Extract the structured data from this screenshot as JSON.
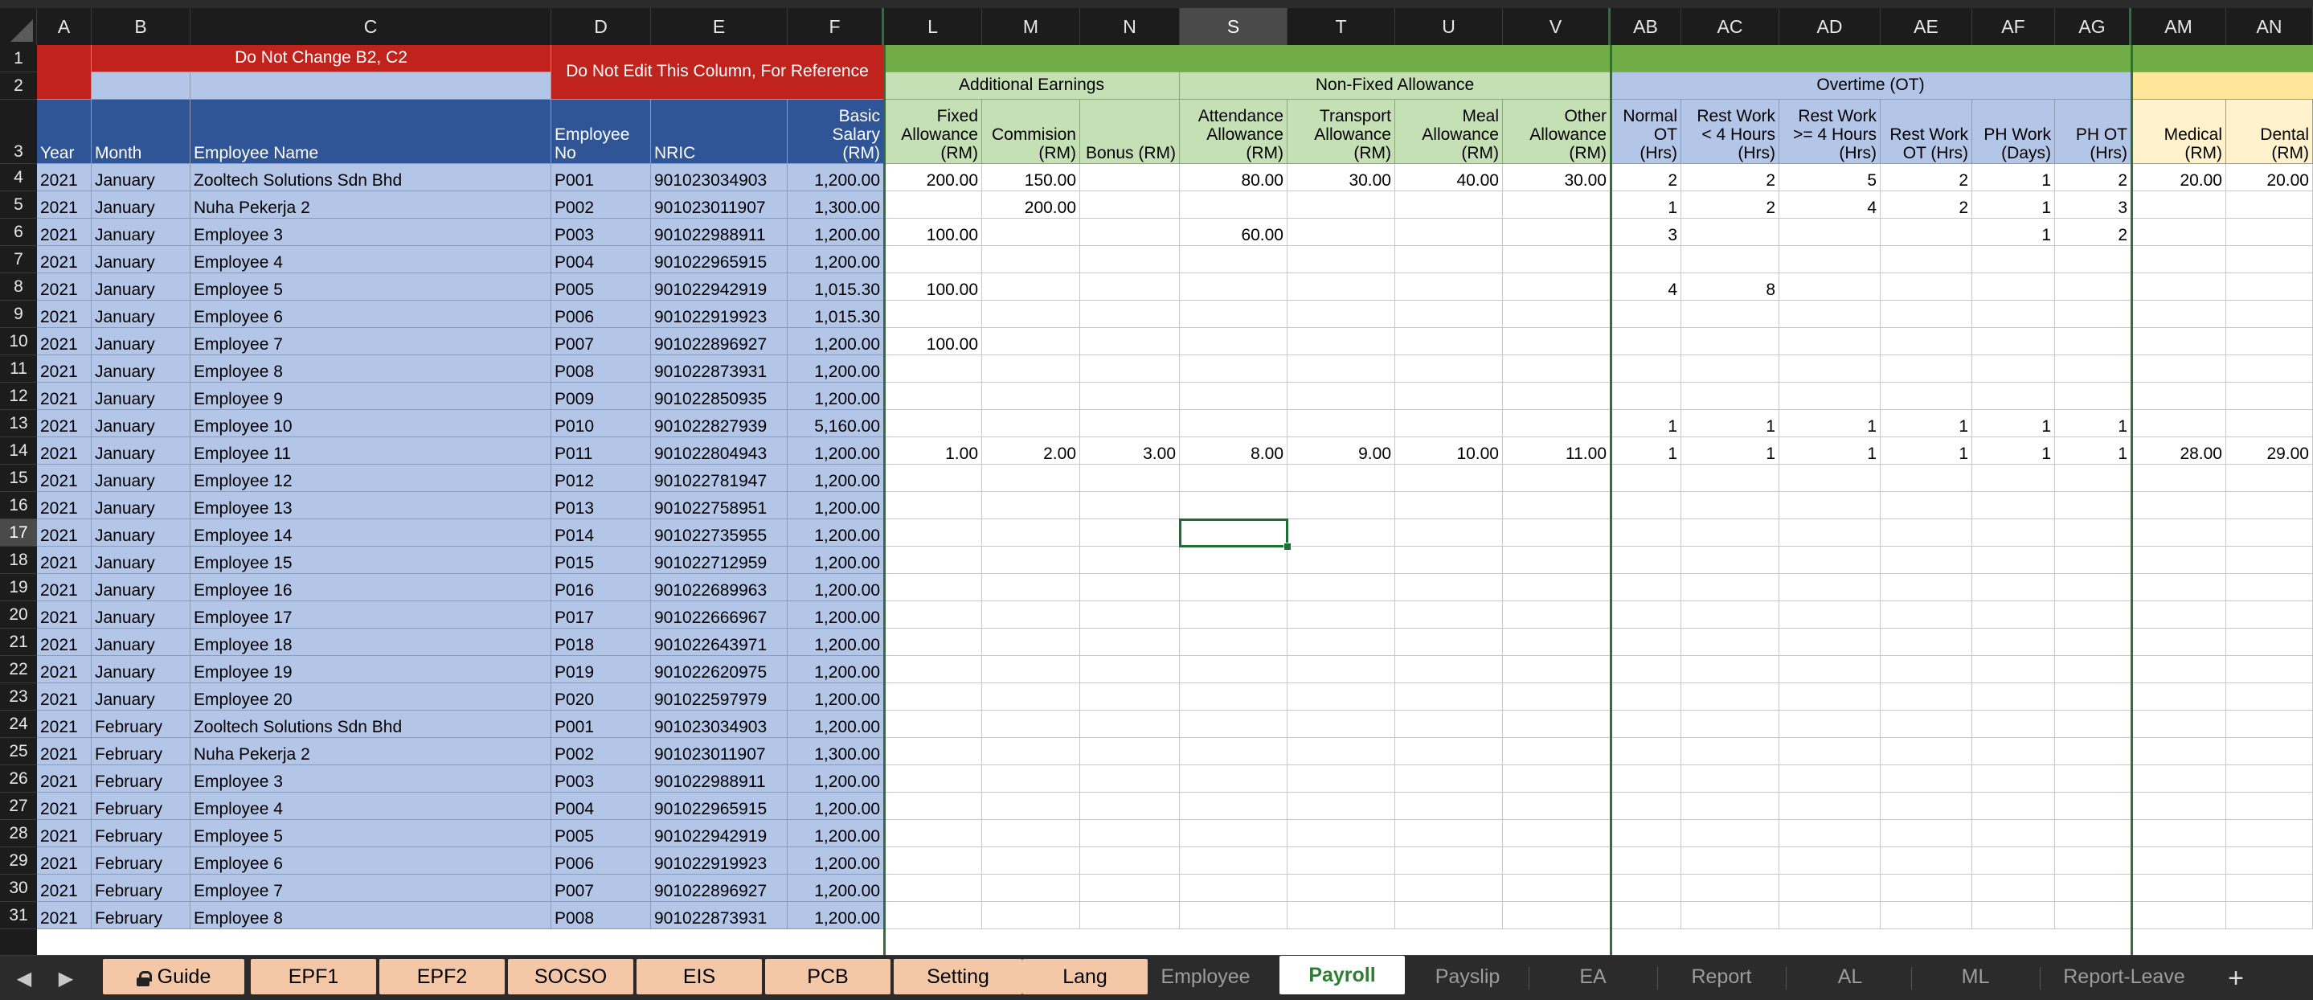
{
  "columns": [
    "A",
    "B",
    "C",
    "D",
    "E",
    "F",
    "L",
    "M",
    "N",
    "S",
    "T",
    "U",
    "V",
    "AB",
    "AC",
    "AD",
    "AE",
    "AF",
    "AG",
    "AM",
    "AN"
  ],
  "selected_column": "S",
  "selected_row": "17",
  "header_rows": {
    "row1_red_left": "Do Not Change B2, C2",
    "row1_2_red_right": "Do Not Edit This Column, For Reference",
    "group_additional": "Additional Earnings",
    "group_nonfixed": "Non-Fixed Allowance",
    "group_overtime": "Overtime (OT)"
  },
  "col_titles": {
    "A": "Year",
    "B": "Month",
    "C": "Employee Name",
    "D": "Employee No",
    "E": "NRIC",
    "F": "Basic Salary (RM)",
    "L": "Fixed Allowance (RM)",
    "M": "Commision (RM)",
    "N": "Bonus (RM)",
    "S": "Attendance Allowance (RM)",
    "T": "Transport Allowance (RM)",
    "U": "Meal Allowance (RM)",
    "V": "Other Allowance (RM)",
    "AB": "Normal OT (Hrs)",
    "AC": "Rest Work < 4 Hours (Hrs)",
    "AD": "Rest Work >= 4 Hours (Hrs)",
    "AE": "Rest Work OT (Hrs)",
    "AF": "PH Work (Days)",
    "AG": "PH OT (Hrs)",
    "AM": "Medical (RM)",
    "AN": "Dental (RM)"
  },
  "rows": [
    {
      "n": "4",
      "A": "2021",
      "B": "January",
      "C": "Zooltech Solutions Sdn Bhd",
      "D": "P001",
      "E": "901023034903",
      "F": "1,200.00",
      "L": "200.00",
      "M": "150.00",
      "N": "",
      "S": "80.00",
      "T": "30.00",
      "U": "40.00",
      "V": "30.00",
      "AB": "2",
      "AC": "2",
      "AD": "5",
      "AE": "2",
      "AF": "1",
      "AG": "2",
      "AM": "20.00",
      "AN": "20.00"
    },
    {
      "n": "5",
      "A": "2021",
      "B": "January",
      "C": "Nuha Pekerja 2",
      "D": "P002",
      "E": "901023011907",
      "F": "1,300.00",
      "L": "",
      "M": "200.00",
      "N": "",
      "S": "",
      "T": "",
      "U": "",
      "V": "",
      "AB": "1",
      "AC": "2",
      "AD": "4",
      "AE": "2",
      "AF": "1",
      "AG": "3",
      "AM": "",
      "AN": ""
    },
    {
      "n": "6",
      "A": "2021",
      "B": "January",
      "C": "Employee 3",
      "D": "P003",
      "E": "901022988911",
      "F": "1,200.00",
      "L": "100.00",
      "M": "",
      "N": "",
      "S": "60.00",
      "T": "",
      "U": "",
      "V": "",
      "AB": "3",
      "AC": "",
      "AD": "",
      "AE": "",
      "AF": "1",
      "AG": "2",
      "AM": "",
      "AN": ""
    },
    {
      "n": "7",
      "A": "2021",
      "B": "January",
      "C": "Employee 4",
      "D": "P004",
      "E": "901022965915",
      "F": "1,200.00",
      "L": "",
      "M": "",
      "N": "",
      "S": "",
      "T": "",
      "U": "",
      "V": "",
      "AB": "",
      "AC": "",
      "AD": "",
      "AE": "",
      "AF": "",
      "AG": "",
      "AM": "",
      "AN": ""
    },
    {
      "n": "8",
      "A": "2021",
      "B": "January",
      "C": "Employee 5",
      "D": "P005",
      "E": "901022942919",
      "F": "1,015.30",
      "L": "100.00",
      "M": "",
      "N": "",
      "S": "",
      "T": "",
      "U": "",
      "V": "",
      "AB": "4",
      "AC": "8",
      "AD": "",
      "AE": "",
      "AF": "",
      "AG": "",
      "AM": "",
      "AN": ""
    },
    {
      "n": "9",
      "A": "2021",
      "B": "January",
      "C": "Employee 6",
      "D": "P006",
      "E": "901022919923",
      "F": "1,015.30",
      "L": "",
      "M": "",
      "N": "",
      "S": "",
      "T": "",
      "U": "",
      "V": "",
      "AB": "",
      "AC": "",
      "AD": "",
      "AE": "",
      "AF": "",
      "AG": "",
      "AM": "",
      "AN": ""
    },
    {
      "n": "10",
      "A": "2021",
      "B": "January",
      "C": "Employee 7",
      "D": "P007",
      "E": "901022896927",
      "F": "1,200.00",
      "L": "100.00",
      "M": "",
      "N": "",
      "S": "",
      "T": "",
      "U": "",
      "V": "",
      "AB": "",
      "AC": "",
      "AD": "",
      "AE": "",
      "AF": "",
      "AG": "",
      "AM": "",
      "AN": ""
    },
    {
      "n": "11",
      "A": "2021",
      "B": "January",
      "C": "Employee 8",
      "D": "P008",
      "E": "901022873931",
      "F": "1,200.00",
      "L": "",
      "M": "",
      "N": "",
      "S": "",
      "T": "",
      "U": "",
      "V": "",
      "AB": "",
      "AC": "",
      "AD": "",
      "AE": "",
      "AF": "",
      "AG": "",
      "AM": "",
      "AN": ""
    },
    {
      "n": "12",
      "A": "2021",
      "B": "January",
      "C": "Employee 9",
      "D": "P009",
      "E": "901022850935",
      "F": "1,200.00",
      "L": "",
      "M": "",
      "N": "",
      "S": "",
      "T": "",
      "U": "",
      "V": "",
      "AB": "",
      "AC": "",
      "AD": "",
      "AE": "",
      "AF": "",
      "AG": "",
      "AM": "",
      "AN": ""
    },
    {
      "n": "13",
      "A": "2021",
      "B": "January",
      "C": "Employee 10",
      "D": "P010",
      "E": "901022827939",
      "F": "5,160.00",
      "L": "",
      "M": "",
      "N": "",
      "S": "",
      "T": "",
      "U": "",
      "V": "",
      "AB": "1",
      "AC": "1",
      "AD": "1",
      "AE": "1",
      "AF": "1",
      "AG": "1",
      "AM": "",
      "AN": ""
    },
    {
      "n": "14",
      "A": "2021",
      "B": "January",
      "C": "Employee 11",
      "D": "P011",
      "E": "901022804943",
      "F": "1,200.00",
      "L": "1.00",
      "M": "2.00",
      "N": "3.00",
      "S": "8.00",
      "T": "9.00",
      "U": "10.00",
      "V": "11.00",
      "AB": "1",
      "AC": "1",
      "AD": "1",
      "AE": "1",
      "AF": "1",
      "AG": "1",
      "AM": "28.00",
      "AN": "29.00"
    },
    {
      "n": "15",
      "A": "2021",
      "B": "January",
      "C": "Employee 12",
      "D": "P012",
      "E": "901022781947",
      "F": "1,200.00"
    },
    {
      "n": "16",
      "A": "2021",
      "B": "January",
      "C": "Employee 13",
      "D": "P013",
      "E": "901022758951",
      "F": "1,200.00"
    },
    {
      "n": "17",
      "A": "2021",
      "B": "January",
      "C": "Employee 14",
      "D": "P014",
      "E": "901022735955",
      "F": "1,200.00"
    },
    {
      "n": "18",
      "A": "2021",
      "B": "January",
      "C": "Employee 15",
      "D": "P015",
      "E": "901022712959",
      "F": "1,200.00"
    },
    {
      "n": "19",
      "A": "2021",
      "B": "January",
      "C": "Employee 16",
      "D": "P016",
      "E": "901022689963",
      "F": "1,200.00"
    },
    {
      "n": "20",
      "A": "2021",
      "B": "January",
      "C": "Employee 17",
      "D": "P017",
      "E": "901022666967",
      "F": "1,200.00"
    },
    {
      "n": "21",
      "A": "2021",
      "B": "January",
      "C": "Employee 18",
      "D": "P018",
      "E": "901022643971",
      "F": "1,200.00"
    },
    {
      "n": "22",
      "A": "2021",
      "B": "January",
      "C": "Employee 19",
      "D": "P019",
      "E": "901022620975",
      "F": "1,200.00"
    },
    {
      "n": "23",
      "A": "2021",
      "B": "January",
      "C": "Employee 20",
      "D": "P020",
      "E": "901022597979",
      "F": "1,200.00"
    },
    {
      "n": "24",
      "A": "2021",
      "B": "February",
      "C": "Zooltech Solutions Sdn Bhd",
      "D": "P001",
      "E": "901023034903",
      "F": "1,200.00"
    },
    {
      "n": "25",
      "A": "2021",
      "B": "February",
      "C": "Nuha Pekerja 2",
      "D": "P002",
      "E": "901023011907",
      "F": "1,300.00"
    },
    {
      "n": "26",
      "A": "2021",
      "B": "February",
      "C": "Employee 3",
      "D": "P003",
      "E": "901022988911",
      "F": "1,200.00"
    },
    {
      "n": "27",
      "A": "2021",
      "B": "February",
      "C": "Employee 4",
      "D": "P004",
      "E": "901022965915",
      "F": "1,200.00"
    },
    {
      "n": "28",
      "A": "2021",
      "B": "February",
      "C": "Employee 5",
      "D": "P005",
      "E": "901022942919",
      "F": "1,200.00"
    },
    {
      "n": "29",
      "A": "2021",
      "B": "February",
      "C": "Employee 6",
      "D": "P006",
      "E": "901022919923",
      "F": "1,200.00"
    },
    {
      "n": "30",
      "A": "2021",
      "B": "February",
      "C": "Employee 7",
      "D": "P007",
      "E": "901022896927",
      "F": "1,200.00"
    },
    {
      "n": "31",
      "A": "2021",
      "B": "February",
      "C": "Employee 8",
      "D": "P008",
      "E": "901022873931",
      "F": "1,200.00"
    }
  ],
  "tabs": {
    "locked": [
      "Guide",
      "EPF1",
      "EPF2",
      "SOCSO",
      "EIS",
      "PCB",
      "Setting",
      "Lang"
    ],
    "plain": [
      "Employee",
      "Payroll",
      "Payslip",
      "EA",
      "Report",
      "AL",
      "ML",
      "Report-Leave"
    ],
    "active": "Payroll",
    "add_label": "+",
    "prev_label": "◀",
    "next_label": "▶"
  }
}
